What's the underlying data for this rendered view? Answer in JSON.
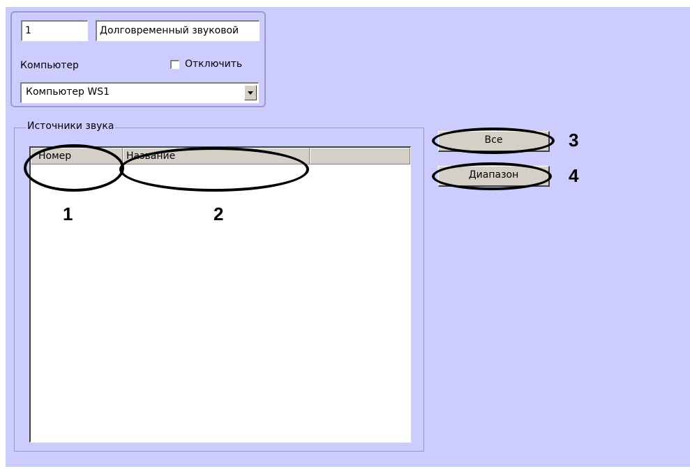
{
  "top_panel": {
    "id_value": "1",
    "name_value": "Долговременный звуковой",
    "computer_label": "Компьютер",
    "disable_label": "Отключить",
    "disable_checked": false,
    "computer_select_value": "Компьютер WS1"
  },
  "sources": {
    "group_title": "Источники звука",
    "columns": [
      "Номер",
      "Название"
    ],
    "rows": []
  },
  "buttons": {
    "all_label": "Все",
    "range_label": "Диапазон"
  },
  "annotations": [
    "1",
    "2",
    "3",
    "4"
  ],
  "icons": {
    "dropdown": "chevron-down-icon"
  },
  "colors": {
    "background": "#ccccff",
    "annotation": "#000000"
  }
}
